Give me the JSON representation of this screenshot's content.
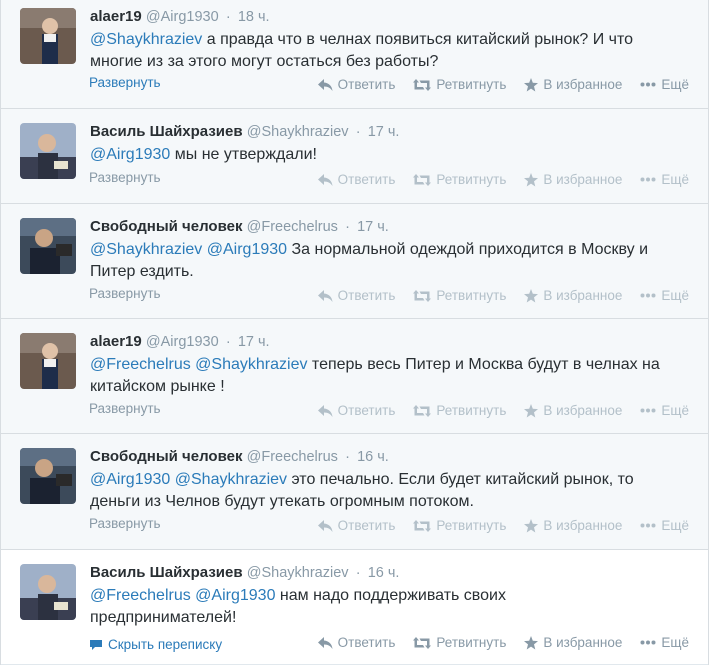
{
  "tweets": [
    {
      "name": "alaer19",
      "handle": "@Airg1930",
      "time": "18 ч.",
      "mentions": [
        "@Shaykhraziev"
      ],
      "text_line1_rest": " а правда что в челнах появиться китайский рынок? И что",
      "text_line2": "многие из за этого могут остаться без работы?",
      "footer_link": "Развернуть"
    },
    {
      "name": "Василь Шайхразиев",
      "handle": "@Shaykhraziev",
      "time": "17 ч.",
      "mentions": [
        "@Airg1930"
      ],
      "text_line1_rest": " мы не утверждали!",
      "text_line2": "",
      "footer_link": "Развернуть"
    },
    {
      "name": "Свободный человек",
      "handle": "@Freechelrus",
      "time": "17 ч.",
      "mentions": [
        "@Shaykhraziev",
        "@Airg1930"
      ],
      "text_line1_rest": " За нормальной одеждой приходится в Москву и",
      "text_line2": "Питер ездить.",
      "footer_link": "Развернуть"
    },
    {
      "name": "alaer19",
      "handle": "@Airg1930",
      "time": "17 ч.",
      "mentions": [
        "@Freechelrus",
        "@Shaykhraziev"
      ],
      "text_line1_rest": " теперь весь Питер и Москва будут в челнах на",
      "text_line2": "китайском рынке !",
      "footer_link": "Развернуть"
    },
    {
      "name": "Свободный человек",
      "handle": "@Freechelrus",
      "time": "16 ч.",
      "mentions": [
        "@Airg1930",
        "@Shaykhraziev"
      ],
      "text_line1_rest": " это печально. Если будет китайский рынок, то",
      "text_line2": "деньги из Челнов будут утекать огромным потоком.",
      "footer_link": "Развернуть"
    },
    {
      "name": "Василь Шайхразиев",
      "handle": "@Shaykhraziev",
      "time": "16 ч.",
      "mentions": [
        "@Freechelrus",
        "@Airg1930"
      ],
      "text_line1_rest": " нам надо поддерживать своих",
      "text_line2": "предпринимателей!",
      "footer_link": "Скрыть переписку"
    }
  ],
  "actions": {
    "reply": "Ответить",
    "retweet": "Ретвитнуть",
    "favorite": "В избранное",
    "more": "Ещё"
  },
  "colors": {
    "link": "#2b7bb9",
    "muted": "#8899a6",
    "background": "#f5f8fa",
    "border": "#d8dde1"
  },
  "icons": [
    "reply-icon",
    "retweet-icon",
    "star-icon",
    "more-dots-icon",
    "conversation-icon"
  ]
}
